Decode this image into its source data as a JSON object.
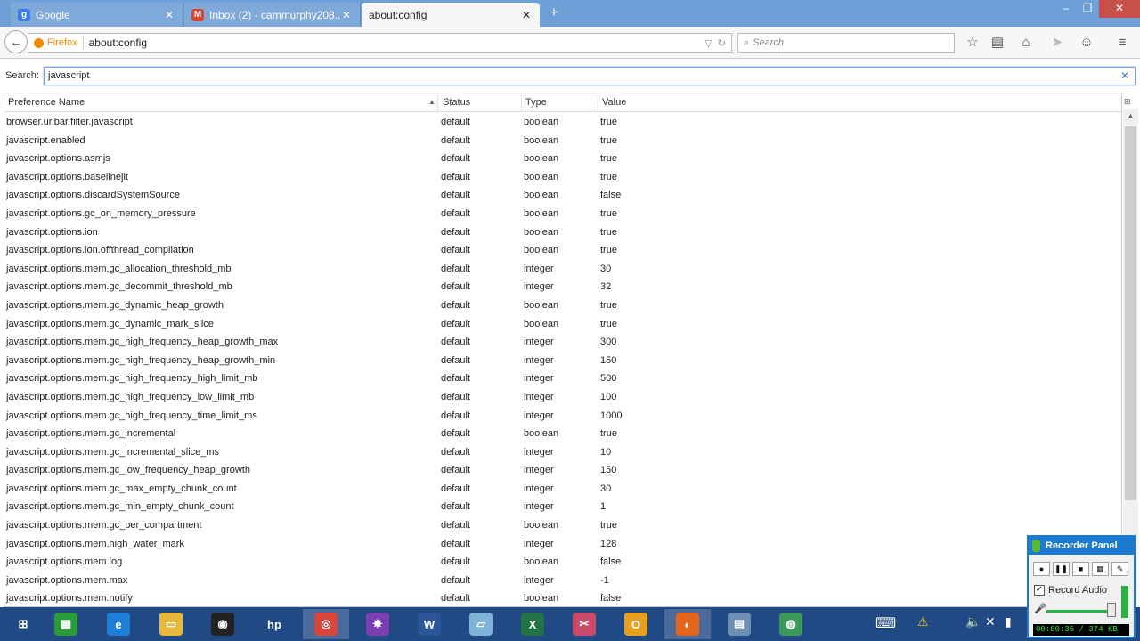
{
  "tabs": [
    {
      "label": "Google",
      "favicon": "google-icon",
      "fav_letter": "g",
      "fav_color": "#3b7de8",
      "active": false
    },
    {
      "label": "Inbox (2) - cammurphy208...",
      "favicon": "gmail-icon",
      "fav_letter": "M",
      "fav_color": "#d94435",
      "active": false
    },
    {
      "label": "about:config",
      "favicon": "",
      "fav_letter": "",
      "fav_color": "",
      "active": true
    }
  ],
  "window_controls": {
    "minimize": "–",
    "restore": "❐",
    "close": "✕"
  },
  "navbar": {
    "identity_label": "Firefox",
    "url": "about:config",
    "search_placeholder": "Search"
  },
  "config_search": {
    "label": "Search:",
    "value": "javascript",
    "clear": "✕"
  },
  "table": {
    "headers": {
      "name": "Preference Name",
      "status": "Status",
      "type": "Type",
      "value": "Value"
    },
    "rows": [
      {
        "name": "browser.urlbar.filter.javascript",
        "status": "default",
        "type": "boolean",
        "value": "true"
      },
      {
        "name": "javascript.enabled",
        "status": "default",
        "type": "boolean",
        "value": "true"
      },
      {
        "name": "javascript.options.asmjs",
        "status": "default",
        "type": "boolean",
        "value": "true"
      },
      {
        "name": "javascript.options.baselinejit",
        "status": "default",
        "type": "boolean",
        "value": "true"
      },
      {
        "name": "javascript.options.discardSystemSource",
        "status": "default",
        "type": "boolean",
        "value": "false"
      },
      {
        "name": "javascript.options.gc_on_memory_pressure",
        "status": "default",
        "type": "boolean",
        "value": "true"
      },
      {
        "name": "javascript.options.ion",
        "status": "default",
        "type": "boolean",
        "value": "true"
      },
      {
        "name": "javascript.options.ion.offthread_compilation",
        "status": "default",
        "type": "boolean",
        "value": "true"
      },
      {
        "name": "javascript.options.mem.gc_allocation_threshold_mb",
        "status": "default",
        "type": "integer",
        "value": "30"
      },
      {
        "name": "javascript.options.mem.gc_decommit_threshold_mb",
        "status": "default",
        "type": "integer",
        "value": "32"
      },
      {
        "name": "javascript.options.mem.gc_dynamic_heap_growth",
        "status": "default",
        "type": "boolean",
        "value": "true"
      },
      {
        "name": "javascript.options.mem.gc_dynamic_mark_slice",
        "status": "default",
        "type": "boolean",
        "value": "true"
      },
      {
        "name": "javascript.options.mem.gc_high_frequency_heap_growth_max",
        "status": "default",
        "type": "integer",
        "value": "300"
      },
      {
        "name": "javascript.options.mem.gc_high_frequency_heap_growth_min",
        "status": "default",
        "type": "integer",
        "value": "150"
      },
      {
        "name": "javascript.options.mem.gc_high_frequency_high_limit_mb",
        "status": "default",
        "type": "integer",
        "value": "500"
      },
      {
        "name": "javascript.options.mem.gc_high_frequency_low_limit_mb",
        "status": "default",
        "type": "integer",
        "value": "100"
      },
      {
        "name": "javascript.options.mem.gc_high_frequency_time_limit_ms",
        "status": "default",
        "type": "integer",
        "value": "1000"
      },
      {
        "name": "javascript.options.mem.gc_incremental",
        "status": "default",
        "type": "boolean",
        "value": "true"
      },
      {
        "name": "javascript.options.mem.gc_incremental_slice_ms",
        "status": "default",
        "type": "integer",
        "value": "10"
      },
      {
        "name": "javascript.options.mem.gc_low_frequency_heap_growth",
        "status": "default",
        "type": "integer",
        "value": "150"
      },
      {
        "name": "javascript.options.mem.gc_max_empty_chunk_count",
        "status": "default",
        "type": "integer",
        "value": "30"
      },
      {
        "name": "javascript.options.mem.gc_min_empty_chunk_count",
        "status": "default",
        "type": "integer",
        "value": "1"
      },
      {
        "name": "javascript.options.mem.gc_per_compartment",
        "status": "default",
        "type": "boolean",
        "value": "true"
      },
      {
        "name": "javascript.options.mem.high_water_mark",
        "status": "default",
        "type": "integer",
        "value": "128"
      },
      {
        "name": "javascript.options.mem.log",
        "status": "default",
        "type": "boolean",
        "value": "false"
      },
      {
        "name": "javascript.options.mem.max",
        "status": "default",
        "type": "integer",
        "value": "-1"
      },
      {
        "name": "javascript.options.mem.notify",
        "status": "default",
        "type": "boolean",
        "value": "false"
      }
    ]
  },
  "taskbar": {
    "items": [
      {
        "name": "start-button",
        "icon": "windows-icon",
        "color": "#214a84",
        "glyph": "⊞"
      },
      {
        "name": "store-app",
        "icon": "store-icon",
        "color": "#2a9d3a",
        "glyph": "▦"
      },
      {
        "name": "internet-explorer-app",
        "icon": "ie-icon",
        "color": "#1e7fd8",
        "glyph": "e"
      },
      {
        "name": "file-explorer-app",
        "icon": "folder-icon",
        "color": "#e8b83a",
        "glyph": "▭"
      },
      {
        "name": "camera-app",
        "icon": "camera-icon",
        "color": "#222222",
        "glyph": "◉"
      },
      {
        "name": "hp-app",
        "icon": "hp-icon",
        "color": "#214a84",
        "glyph": "hp"
      },
      {
        "name": "chrome-app",
        "icon": "chrome-icon",
        "color": "#d9463b",
        "glyph": "◎"
      },
      {
        "name": "media-app",
        "icon": "media-icon",
        "color": "#7a3fb2",
        "glyph": "✸"
      },
      {
        "name": "word-app",
        "icon": "word-icon",
        "color": "#2b579a",
        "glyph": "W"
      },
      {
        "name": "tablet-app",
        "icon": "tablet-icon",
        "color": "#7fb3d8",
        "glyph": "▱"
      },
      {
        "name": "excel-app",
        "icon": "excel-icon",
        "color": "#217346",
        "glyph": "X"
      },
      {
        "name": "snipping-app",
        "icon": "scissors-icon",
        "color": "#c94a6b",
        "glyph": "✂"
      },
      {
        "name": "outlook-app",
        "icon": "outlook-icon",
        "color": "#e6a01e",
        "glyph": "O"
      },
      {
        "name": "firefox-app",
        "icon": "firefox-icon",
        "color": "#e5661a",
        "glyph": "◐"
      },
      {
        "name": "calculator-app",
        "icon": "calculator-icon",
        "color": "#6d8fb3",
        "glyph": "▤"
      },
      {
        "name": "network-app",
        "icon": "globe-icon",
        "color": "#3a9a5c",
        "glyph": "◍"
      }
    ]
  },
  "recorder": {
    "title": "Recorder Panel",
    "record_audio_label": "Record Audio",
    "record_audio_checked": "✓",
    "status": "00:00:35 / 374 KB",
    "buttons": [
      "●",
      "❚❚",
      "■",
      "▦",
      "✎"
    ]
  }
}
